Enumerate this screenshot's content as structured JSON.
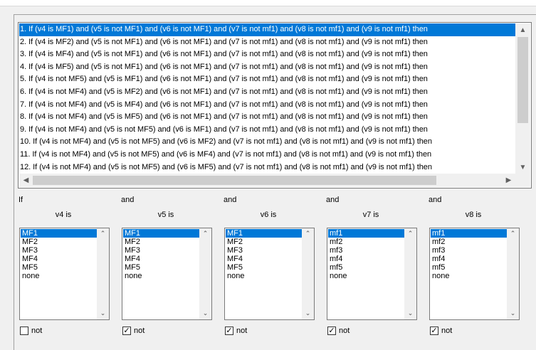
{
  "rules": [
    "1. If (v4 is MF1) and (v5 is not MF1) and (v6 is not MF1) and (v7 is not mf1) and (v8 is not mf1) and (v9 is not mf1) then",
    "2. If (v4 is MF2) and (v5 is not MF1) and (v6 is not MF1) and (v7 is not mf1) and (v8 is not mf1) and (v9 is not mf1) then",
    "3. If (v4 is MF4) and (v5 is not MF1) and (v6 is not MF1) and (v7 is not mf1) and (v8 is not mf1) and (v9 is not mf1) then",
    "4. If (v4 is MF5) and (v5 is not MF1) and (v6 is not MF1) and (v7 is not mf1) and (v8 is not mf1) and (v9 is not mf1) then",
    "5. If (v4 is not MF5) and (v5 is MF1) and (v6 is not MF1) and (v7 is not mf1) and (v8 is not mf1) and (v9 is not mf1) then",
    "6. If (v4 is not MF4) and (v5 is MF2) and (v6 is not MF1) and (v7 is not mf1) and (v8 is not mf1) and (v9 is not mf1) then",
    "7. If (v4 is not MF4) and (v5 is MF4) and (v6 is not MF1) and (v7 is not mf1) and (v8 is not mf1) and (v9 is not mf1) then",
    "8. If (v4 is not MF4) and (v5 is MF5) and (v6 is not MF1) and (v7 is not mf1) and (v8 is not mf1) and (v9 is not mf1) then",
    "9. If (v4 is not MF4) and (v5 is not MF5) and (v6 is MF1) and (v7 is not mf1) and (v8 is not mf1) and (v9 is not mf1) then",
    "10. If (v4 is not MF4) and (v5 is not MF5) and (v6 is MF2) and (v7 is not mf1) and (v8 is not mf1) and (v9 is not mf1) then",
    "11. If (v4 is not MF4) and (v5 is not MF5) and (v6 is MF4) and (v7 is not mf1) and (v8 is not mf1) and (v9 is not mf1) then",
    "12. If (v4 is not MF4) and (v5 is not MF5) and (v6 is MF5) and (v7 is not mf1) and (v8 is not mf1) and (v9 is not mf1) then"
  ],
  "selected_rule_index": 0,
  "columns": [
    {
      "connector": "If",
      "var_label": "v4 is",
      "options": [
        "MF1",
        "MF2",
        "MF3",
        "MF4",
        "MF5",
        "none"
      ],
      "selected": "MF1",
      "not_checked": false,
      "not_label": "not"
    },
    {
      "connector": "and",
      "var_label": "v5 is",
      "options": [
        "MF1",
        "MF2",
        "MF3",
        "MF4",
        "MF5",
        "none"
      ],
      "selected": "MF1",
      "not_checked": true,
      "not_label": "not"
    },
    {
      "connector": "and",
      "var_label": "v6 is",
      "options": [
        "MF1",
        "MF2",
        "MF3",
        "MF4",
        "MF5",
        "none"
      ],
      "selected": "MF1",
      "not_checked": true,
      "not_label": "not"
    },
    {
      "connector": "and",
      "var_label": "v7 is",
      "options": [
        "mf1",
        "mf2",
        "mf3",
        "mf4",
        "mf5",
        "none"
      ],
      "selected": "mf1",
      "not_checked": true,
      "not_label": "not"
    },
    {
      "connector": "and",
      "var_label": "v8 is",
      "options": [
        "mf1",
        "mf2",
        "mf3",
        "mf4",
        "mf5",
        "none"
      ],
      "selected": "mf1",
      "not_checked": true,
      "not_label": "not"
    }
  ],
  "icons": {
    "scroll_up": "chevron-up-icon",
    "scroll_down": "chevron-down-icon",
    "scroll_left": "chevron-left-icon",
    "scroll_right": "chevron-right-icon",
    "check": "checkmark-icon"
  },
  "colors": {
    "selection": "#0078d7",
    "background": "#f0f0f0"
  }
}
